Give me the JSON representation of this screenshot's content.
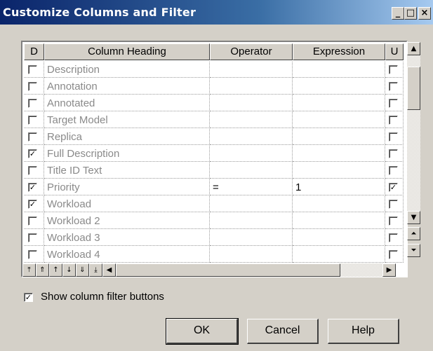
{
  "window": {
    "title": "Customize Columns and Filter",
    "minimize_icon": "_",
    "maximize_icon": "□",
    "close_icon": "×"
  },
  "grid": {
    "headers": {
      "d": "D",
      "column_heading": "Column Heading",
      "operator": "Operator",
      "expression": "Expression",
      "u": "U"
    },
    "rows": [
      {
        "d": false,
        "heading": "Description",
        "operator": "",
        "expression": "",
        "u": false,
        "enabled": false
      },
      {
        "d": false,
        "heading": "Annotation",
        "operator": "",
        "expression": "",
        "u": false,
        "enabled": false
      },
      {
        "d": false,
        "heading": "Annotated",
        "operator": "",
        "expression": "",
        "u": false,
        "enabled": false
      },
      {
        "d": false,
        "heading": "Target Model",
        "operator": "",
        "expression": "",
        "u": false,
        "enabled": false
      },
      {
        "d": false,
        "heading": "Replica",
        "operator": "",
        "expression": "",
        "u": false,
        "enabled": false
      },
      {
        "d": true,
        "heading": "Full Description",
        "operator": "",
        "expression": "",
        "u": false,
        "enabled": false
      },
      {
        "d": false,
        "heading": "Title ID Text",
        "operator": "",
        "expression": "",
        "u": false,
        "enabled": false
      },
      {
        "d": true,
        "heading": "Priority",
        "operator": "=",
        "expression": "1",
        "u": true,
        "enabled": false
      },
      {
        "d": true,
        "heading": "Workload",
        "operator": "",
        "expression": "",
        "u": false,
        "enabled": false
      },
      {
        "d": false,
        "heading": "Workload 2",
        "operator": "",
        "expression": "",
        "u": false,
        "enabled": false
      },
      {
        "d": false,
        "heading": "Workload 3",
        "operator": "",
        "expression": "",
        "u": false,
        "enabled": false
      },
      {
        "d": false,
        "heading": "Workload 4",
        "operator": "",
        "expression": "",
        "u": false,
        "enabled": false
      }
    ]
  },
  "navigation": {
    "move_top_icon": "⤒",
    "move_up_many_icon": "⇑",
    "move_up_icon": "↑",
    "move_down_icon": "↓",
    "move_down_many_icon": "⇓",
    "move_bottom_icon": "⤓",
    "scroll_left_icon": "◀",
    "scroll_right_icon": "▶"
  },
  "options": {
    "show_filter_buttons_label": "Show column filter buttons",
    "show_filter_buttons_checked": true
  },
  "buttons": {
    "ok": "OK",
    "cancel": "Cancel",
    "help": "Help"
  }
}
